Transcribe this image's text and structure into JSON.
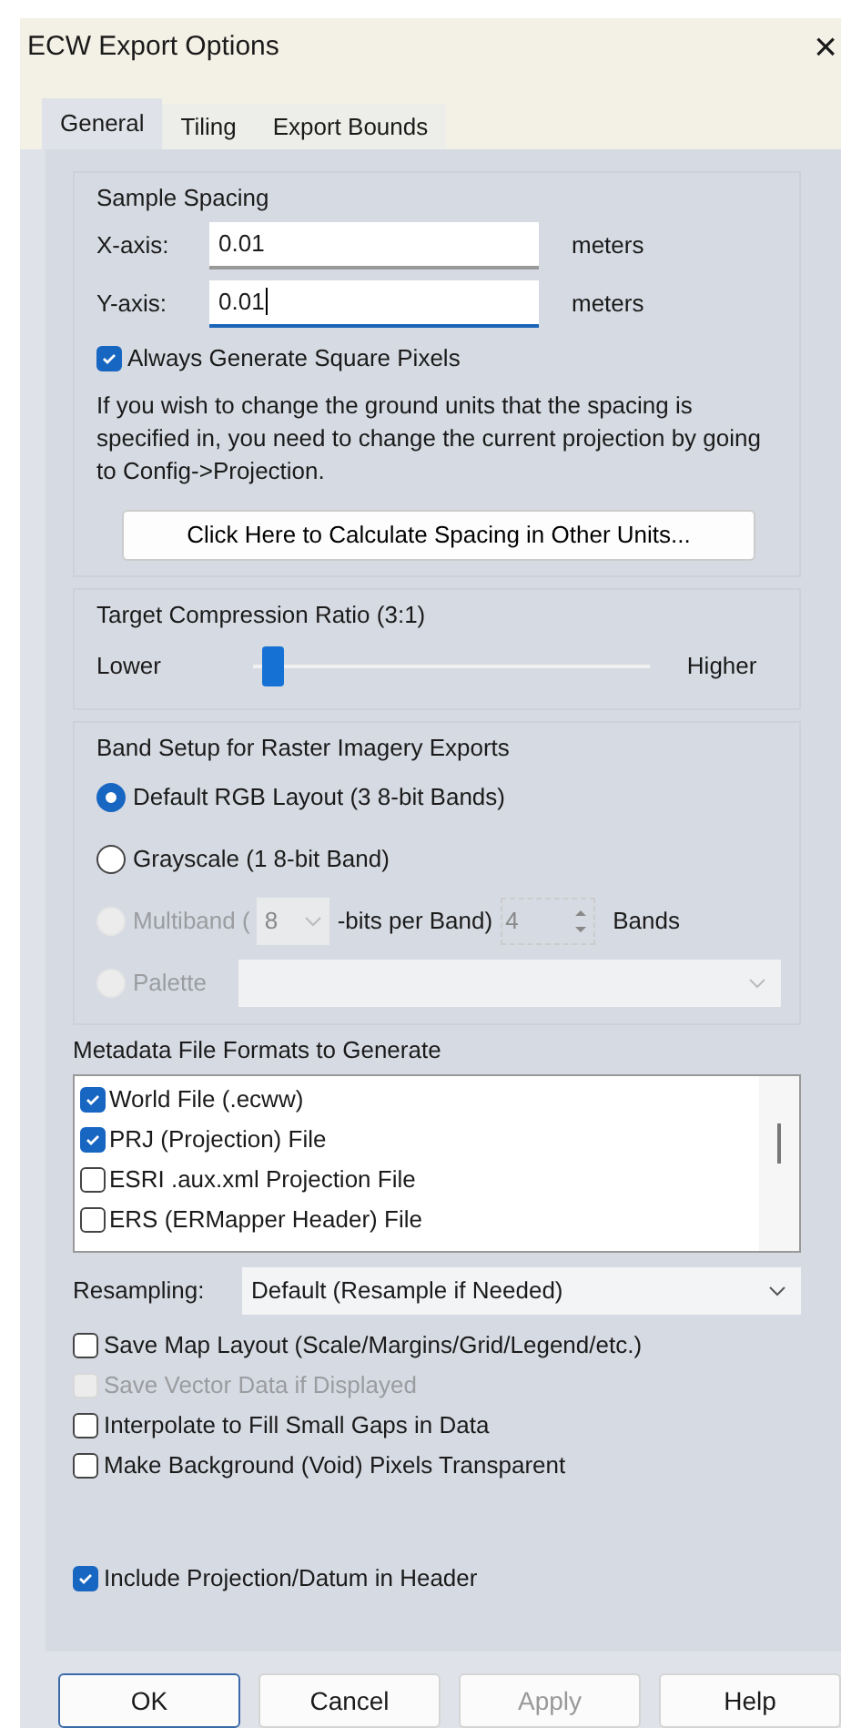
{
  "window": {
    "title": "ECW Export Options",
    "close": "×"
  },
  "tabs": [
    {
      "label": "General",
      "selected": true
    },
    {
      "label": "Tiling",
      "selected": false
    },
    {
      "label": "Export Bounds",
      "selected": false
    }
  ],
  "sample_spacing": {
    "title": "Sample Spacing",
    "fields": [
      {
        "label": "X-axis:",
        "value": "0.01",
        "unit": "meters",
        "focused": false
      },
      {
        "label": "Y-axis:",
        "value": "0.01",
        "unit": "meters",
        "focused": true
      }
    ],
    "square_pixels": {
      "label": "Always Generate Square Pixels",
      "checked": true
    },
    "note": "If you wish to change the ground units that the spacing is specified in, you need to change the current projection by going to Config->Projection.",
    "calc_button": "Click Here to Calculate Spacing in Other Units..."
  },
  "compression": {
    "title": "Target Compression Ratio (3:1)",
    "low": "Lower",
    "high": "Higher",
    "level": 0.02
  },
  "band_setup": {
    "title": "Band Setup for Raster Imagery Exports",
    "options": [
      {
        "kind": "plain",
        "label": "Default RGB Layout (3 8-bit Bands)",
        "selected": true,
        "disabled": false
      },
      {
        "kind": "plain",
        "label": "Grayscale (1 8-bit Band)",
        "selected": false,
        "disabled": false
      },
      {
        "kind": "multiband",
        "label": "Multiband (",
        "bits": "8",
        "bits_label": "-bits per Band)",
        "bands": "4",
        "bands_label": "Bands",
        "selected": false,
        "disabled": true
      },
      {
        "kind": "palette",
        "label": "Palette",
        "selected": false,
        "disabled": true
      }
    ]
  },
  "metadata": {
    "title": "Metadata File Formats to Generate",
    "items": [
      {
        "label": "World File (.ecww)",
        "checked": true
      },
      {
        "label": "PRJ (Projection) File",
        "checked": true
      },
      {
        "label": "ESRI .aux.xml Projection File",
        "checked": false
      },
      {
        "label": "ERS (ERMapper Header) File",
        "checked": false
      }
    ]
  },
  "resampling": {
    "label": "Resampling:",
    "value": "Default (Resample if Needed)"
  },
  "options": [
    {
      "label": "Save Map Layout (Scale/Margins/Grid/Legend/etc.)",
      "checked": false,
      "disabled": false
    },
    {
      "label": "Save Vector Data if Displayed",
      "checked": false,
      "disabled": true
    },
    {
      "label": "Interpolate to Fill Small Gaps in Data",
      "checked": false,
      "disabled": false
    },
    {
      "label": "Make Background (Void) Pixels Transparent",
      "checked": false,
      "disabled": false
    }
  ],
  "header_option": {
    "label": "Include Projection/Datum in Header",
    "checked": true
  },
  "buttons": [
    {
      "label": "OK",
      "default": true,
      "disabled": false
    },
    {
      "label": "Cancel",
      "default": false,
      "disabled": false
    },
    {
      "label": "Apply",
      "default": false,
      "disabled": true
    },
    {
      "label": "Help",
      "default": false,
      "disabled": false
    }
  ]
}
